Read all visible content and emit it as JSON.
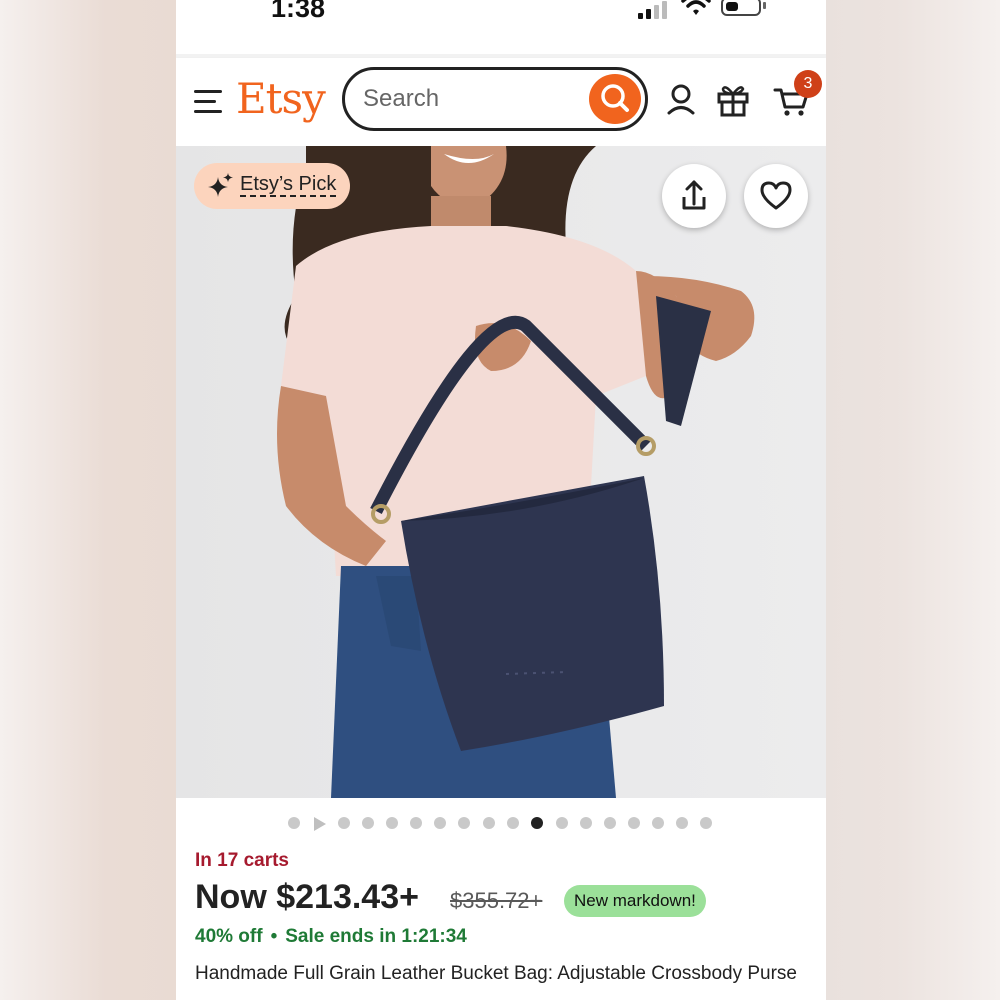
{
  "status_bar": {
    "time": "1:38"
  },
  "header": {
    "logo": "Etsy",
    "search_placeholder": "Search",
    "cart_count": "3"
  },
  "icons": {
    "menu": "menu-icon",
    "search": "search-icon",
    "account": "user-icon",
    "gifts": "gift-icon",
    "cart": "cart-icon",
    "share": "share-icon",
    "favorite": "heart-icon",
    "sparkle": "sparkle-icon"
  },
  "image": {
    "badge_label": "Etsy’s Pick",
    "carousel": {
      "total_images": 18,
      "active_index": 10,
      "has_video": true
    }
  },
  "product": {
    "in_carts": "In 17 carts",
    "price_now": "Now $213.43+",
    "price_original": "$355.72+",
    "markdown_label": "New markdown!",
    "discount": "40% off",
    "separator": "•",
    "sale_ends": "Sale ends in 1:21:34",
    "title": "Handmade Full Grain Leather Bucket Bag: Adjustable Crossbody Purse"
  },
  "colors": {
    "brand_orange": "#f1641e",
    "carts_red": "#a61a2e",
    "sale_green": "#1f7a36",
    "markdown_bg": "#9be099",
    "badge_bg": "#fcd4bd"
  }
}
